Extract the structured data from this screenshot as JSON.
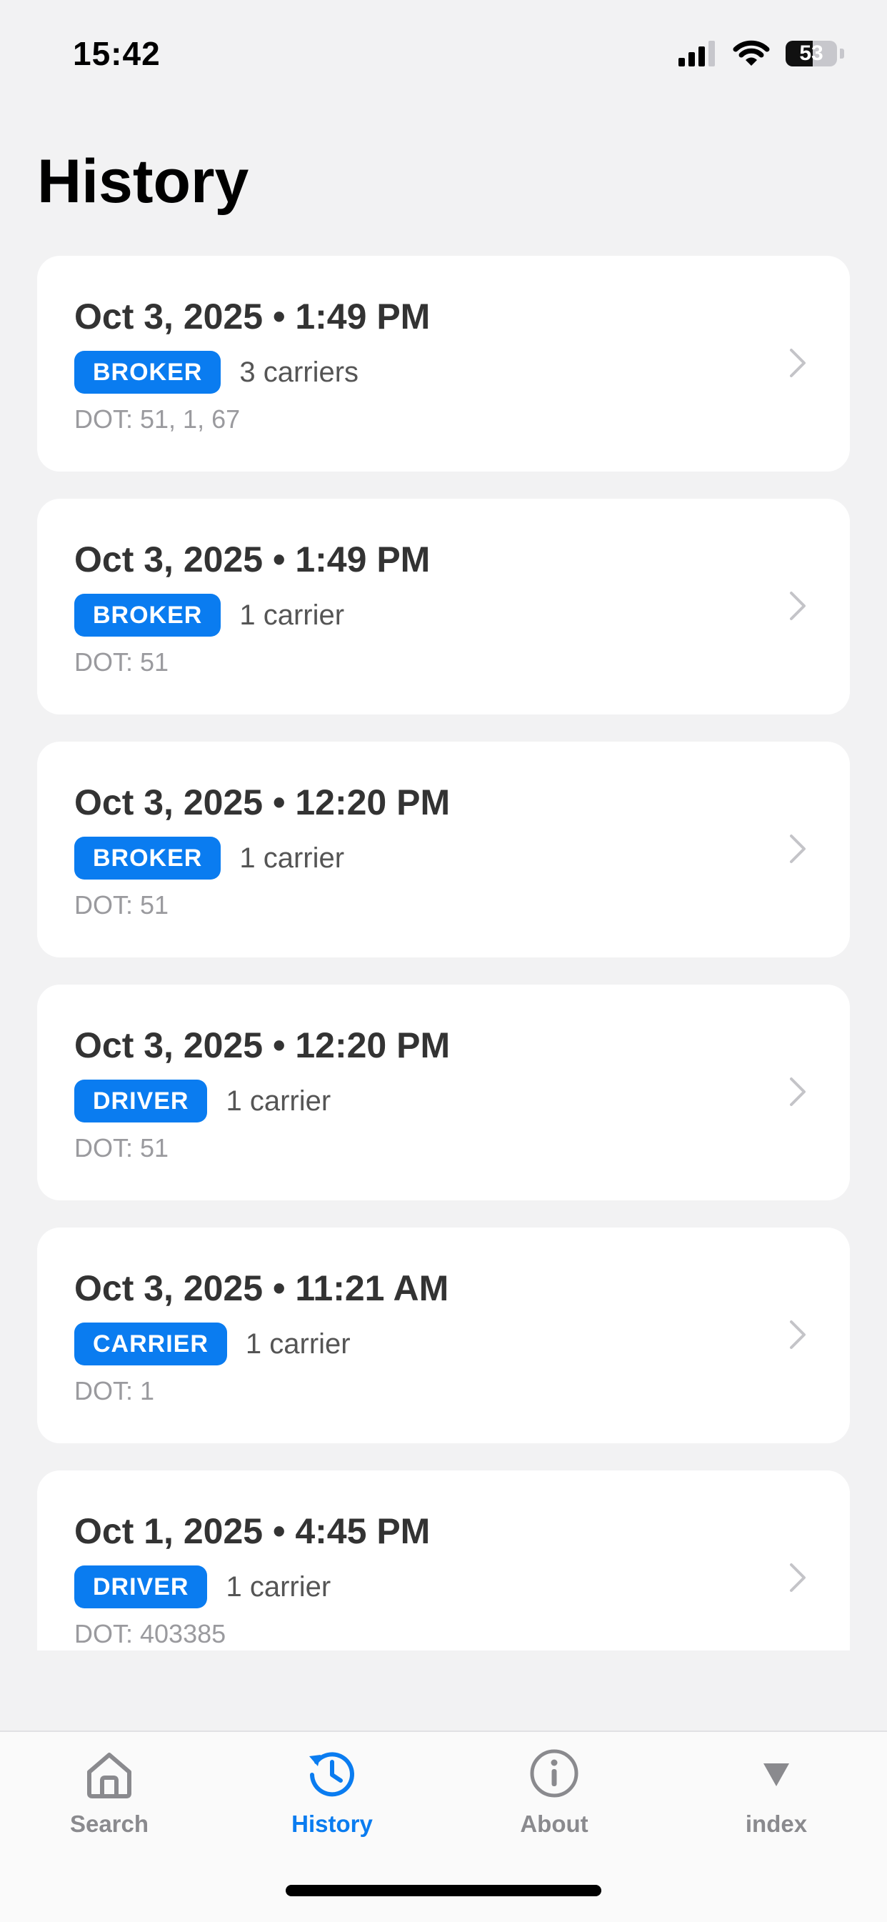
{
  "status_bar": {
    "time": "15:42",
    "battery_percent": "53",
    "battery_level": 0.53,
    "icons": [
      "signal-icon",
      "wifi-icon",
      "battery-icon"
    ]
  },
  "page": {
    "title": "History"
  },
  "history": [
    {
      "date": "Oct 3, 2025 • 1:49 PM",
      "role": "BROKER",
      "carriers": "3 carriers",
      "dot": "DOT: 51, 1, 67"
    },
    {
      "date": "Oct 3, 2025 • 1:49 PM",
      "role": "BROKER",
      "carriers": "1 carrier",
      "dot": "DOT: 51"
    },
    {
      "date": "Oct 3, 2025 • 12:20 PM",
      "role": "BROKER",
      "carriers": "1 carrier",
      "dot": "DOT: 51"
    },
    {
      "date": "Oct 3, 2025 • 12:20 PM",
      "role": "DRIVER",
      "carriers": "1 carrier",
      "dot": "DOT: 51"
    },
    {
      "date": "Oct 3, 2025 • 11:21 AM",
      "role": "CARRIER",
      "carriers": "1 carrier",
      "dot": "DOT: 1"
    },
    {
      "date": "Oct 1, 2025 • 4:45 PM",
      "role": "DRIVER",
      "carriers": "1 carrier",
      "dot": "DOT: 403385"
    }
  ],
  "tab_bar": {
    "tabs": [
      {
        "label": "Search",
        "icon": "home-icon",
        "active": false
      },
      {
        "label": "History",
        "icon": "history-icon",
        "active": true
      },
      {
        "label": "About",
        "icon": "info-icon",
        "active": false
      },
      {
        "label": "index",
        "icon": "triangle-down-icon",
        "active": false
      }
    ]
  },
  "colors": {
    "accent": "#0a7cf0",
    "background": "#f2f2f3",
    "card": "#ffffff",
    "inactive_tab": "#8a8a8e"
  }
}
